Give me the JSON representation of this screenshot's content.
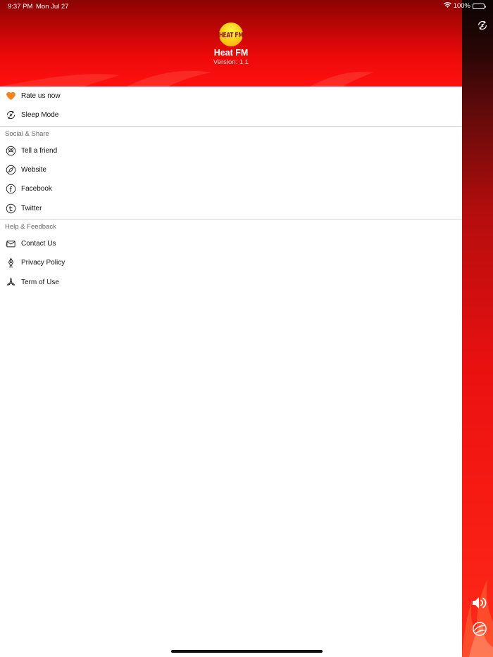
{
  "status_bar": {
    "time": "9:37 PM",
    "date": "Mon Jul 27",
    "battery_percent": "100%",
    "icons": [
      "wifi-icon",
      "battery-icon"
    ]
  },
  "drawer": {
    "logo_text": "HEAT FM",
    "app_name": "Heat FM",
    "version": "Version: 1.1",
    "top_items": [
      {
        "label": "Rate us now",
        "icon": "heart-icon"
      },
      {
        "label": "Sleep Mode",
        "icon": "sleep-timer-icon"
      }
    ],
    "social_section": {
      "title": "Social & Share",
      "items": [
        {
          "label": "Tell a friend",
          "icon": "share-icon"
        },
        {
          "label": "Website",
          "icon": "compass-icon"
        },
        {
          "label": "Facebook",
          "icon": "facebook-icon"
        },
        {
          "label": "Twitter",
          "icon": "twitter-icon"
        }
      ]
    },
    "help_section": {
      "title": "Help & Feedback",
      "items": [
        {
          "label": "Contact Us",
          "icon": "mail-icon"
        },
        {
          "label": "Privacy Policy",
          "icon": "pen-nib-icon"
        },
        {
          "label": "Term of Use",
          "icon": "radiation-icon"
        }
      ]
    }
  },
  "right_panel_icons": [
    "sleep-timer-icon",
    "volume-icon",
    "airplay-icon"
  ],
  "colors": {
    "header_top": "#8c0404",
    "header_bottom": "#ff1010",
    "accent_red": "#e81010",
    "logo_yellow": "#ffd21a",
    "heart_orange": "#f5831f"
  }
}
